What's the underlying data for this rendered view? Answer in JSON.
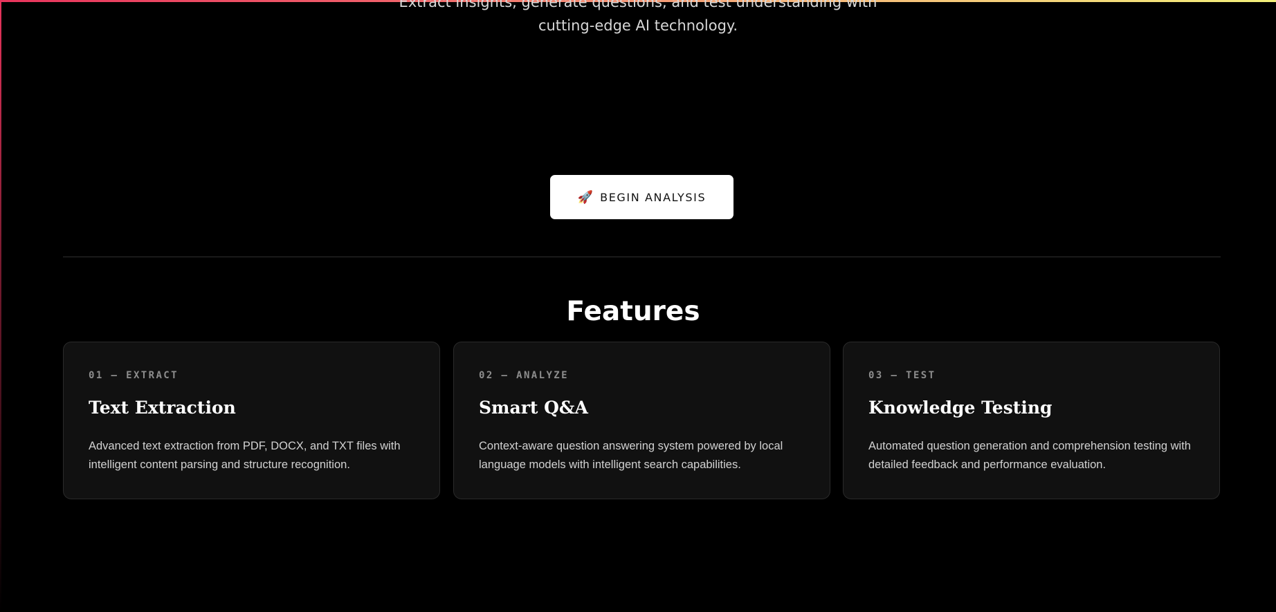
{
  "hero": {
    "subtitle_line1": "Extract insights, generate questions, and test understanding with",
    "subtitle_line2": "cutting-edge AI technology."
  },
  "cta": {
    "icon": "rocket-icon",
    "icon_glyph": "🚀",
    "label": "BEGIN ANALYSIS"
  },
  "features": {
    "title": "Features",
    "cards": [
      {
        "tag": "01 — EXTRACT",
        "title": "Text Extraction",
        "description": "Advanced text extraction from PDF, DOCX, and TXT files with intelligent content parsing and structure recognition."
      },
      {
        "tag": "02 — ANALYZE",
        "title": "Smart Q&A",
        "description": "Context-aware question answering system powered by local language models with intelligent search capabilities."
      },
      {
        "tag": "03 — TEST",
        "title": "Knowledge Testing",
        "description": "Automated question generation and comprehension testing with detailed feedback and performance evaluation."
      }
    ]
  },
  "colors": {
    "background": "#000000",
    "card_background": "#111111",
    "card_border": "#2a2a2a",
    "accent_gradient_start": "#e8345c",
    "accent_gradient_end": "#f3f07a",
    "cta_background": "#ffffff",
    "rocket": "#d6204f"
  }
}
